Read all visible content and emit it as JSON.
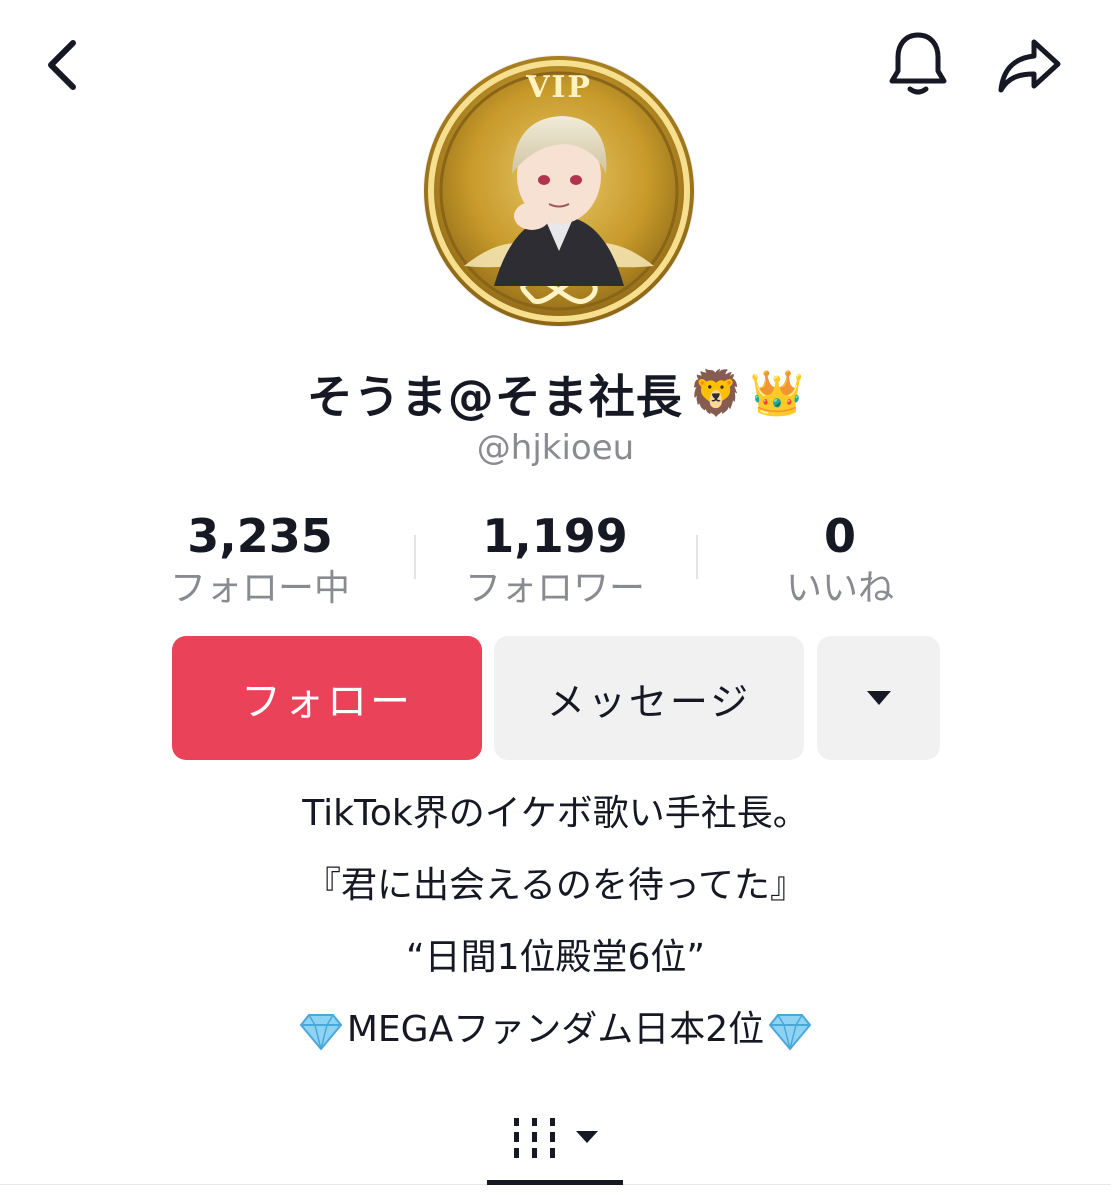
{
  "header": {
    "back_icon": "chevron-left-icon",
    "notification_icon": "bell-icon",
    "share_icon": "share-arrow-icon"
  },
  "profile": {
    "avatar_badge": "VIP",
    "display_name": "そうま@そま社長",
    "name_emojis": [
      "🦁",
      "👑"
    ],
    "username": "@hjkioeu"
  },
  "stats": [
    {
      "value": "3,235",
      "label": "フォロー中"
    },
    {
      "value": "1,199",
      "label": "フォロワー"
    },
    {
      "value": "0",
      "label": "いいね"
    }
  ],
  "actions": {
    "follow_label": "フォロー",
    "message_label": "メッセージ",
    "more_icon": "caret-down-icon"
  },
  "bio": {
    "line1": "TikTok界のイケボ歌い手社長。",
    "line2": "『君に出会えるのを待ってた』",
    "line3": "“日間1位殿堂6位”",
    "line4": "MEGAファンダム日本2位",
    "line4_icon": "diamond-icon"
  },
  "tabs": {
    "grid_icon": "video-grid-icon",
    "grid_dropdown_icon": "caret-down-icon"
  },
  "colors": {
    "accent": "#ea4359",
    "secondary_bg": "#f1f1f2",
    "muted_text": "#8a8b91",
    "text": "#161823"
  }
}
